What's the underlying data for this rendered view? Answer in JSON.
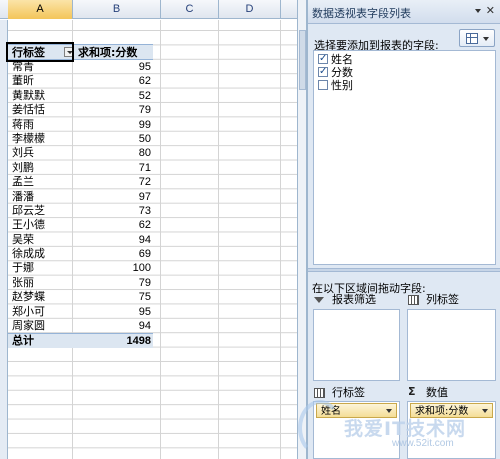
{
  "columns": [
    "A",
    "B",
    "C",
    "D"
  ],
  "pivot": {
    "row_header": "行标签",
    "value_header": "求和项:分数",
    "rows": [
      {
        "name": "常青",
        "value": "95"
      },
      {
        "name": "董昕",
        "value": "62"
      },
      {
        "name": "黄默默",
        "value": "52"
      },
      {
        "name": "姜恬恬",
        "value": "79"
      },
      {
        "name": "蒋雨",
        "value": "99"
      },
      {
        "name": "李檬檬",
        "value": "50"
      },
      {
        "name": "刘兵",
        "value": "80"
      },
      {
        "name": "刘鹏",
        "value": "71"
      },
      {
        "name": "孟兰",
        "value": "72"
      },
      {
        "name": "潘潘",
        "value": "97"
      },
      {
        "name": "邱云芝",
        "value": "73"
      },
      {
        "name": "王小德",
        "value": "62"
      },
      {
        "name": "吴荣",
        "value": "94"
      },
      {
        "name": "徐成成",
        "value": "69"
      },
      {
        "name": "于娜",
        "value": "100"
      },
      {
        "name": "张丽",
        "value": "79"
      },
      {
        "name": "赵梦蝶",
        "value": "75"
      },
      {
        "name": "郑小可",
        "value": "95"
      },
      {
        "name": "周家圆",
        "value": "94"
      }
    ],
    "total_label": "总计",
    "total_value": "1498"
  },
  "field_pane": {
    "title": "数据透视表字段列表",
    "choose_label": "选择要添加到报表的字段:",
    "fields": [
      {
        "label": "姓名",
        "checked": true
      },
      {
        "label": "分数",
        "checked": true
      },
      {
        "label": "性别",
        "checked": false
      }
    ],
    "drag_label": "在以下区域间拖动字段:",
    "areas": {
      "filter": "报表筛选",
      "columns": "列标签",
      "rows": "行标签",
      "values": "数值"
    },
    "row_field": "姓名",
    "value_field": "求和项:分数"
  },
  "watermark": {
    "main": "我爱IT技术网",
    "sub": "www.52it.com"
  }
}
